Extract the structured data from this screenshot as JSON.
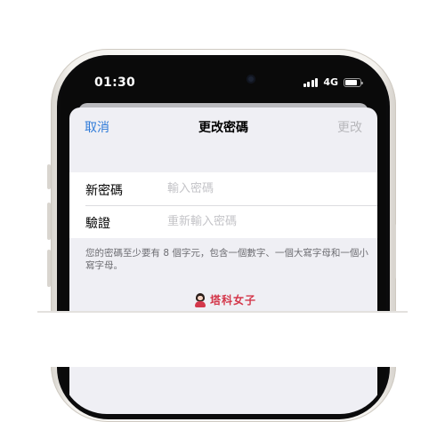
{
  "status_bar": {
    "time": "01:30",
    "network": "4G",
    "battery_icon": "battery-icon",
    "signal_icon": "cellular-signal-icon"
  },
  "nav": {
    "cancel_label": "取消",
    "title": "更改密碼",
    "done_label": "更改"
  },
  "form": {
    "new_password": {
      "label": "新密碼",
      "placeholder": "輸入密碼",
      "value": ""
    },
    "verify": {
      "label": "驗證",
      "placeholder": "重新輸入密碼",
      "value": ""
    }
  },
  "footnote": "您的密碼至少要有 8 個字元，包含一個數字、一個大寫字母和一個小寫字母。",
  "watermark": {
    "text": "塔科女子",
    "color": "#d4384b"
  },
  "colors": {
    "accent": "#2f7bd9",
    "disabled": "#b8b8bc",
    "sheet_background": "#efeff4"
  }
}
